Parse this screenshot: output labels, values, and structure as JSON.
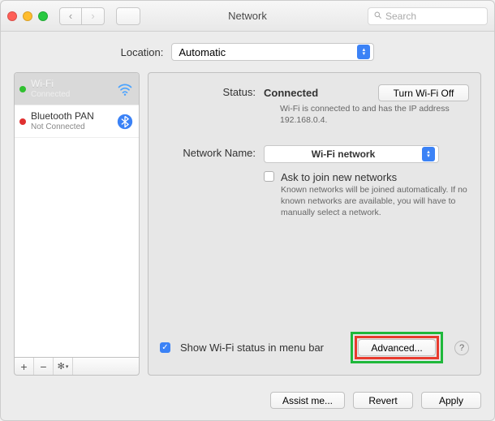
{
  "window": {
    "title": "Network",
    "search_placeholder": "Search"
  },
  "location": {
    "label": "Location:",
    "value": "Automatic"
  },
  "services": [
    {
      "name": "Wi-Fi",
      "status": "Connected",
      "dot": "green",
      "icon": "wifi",
      "selected": true
    },
    {
      "name": "Bluetooth PAN",
      "status": "Not Connected",
      "dot": "red",
      "icon": "bluetooth",
      "selected": false
    }
  ],
  "detail": {
    "status_label": "Status:",
    "status_value": "Connected",
    "wifi_toggle": "Turn Wi-Fi Off",
    "status_desc": "Wi-Fi is connected to and has the IP address 192.168.0.4.",
    "network_name_label": "Network Name:",
    "network_name_value": "Wi-Fi network",
    "ask_join_label": "Ask to join new networks",
    "ask_join_desc": "Known networks will be joined automatically. If no known networks are available, you will have to manually select a network.",
    "show_status_label": "Show Wi-Fi status in menu bar",
    "advanced_label": "Advanced..."
  },
  "footer": {
    "assist": "Assist me...",
    "revert": "Revert",
    "apply": "Apply"
  }
}
